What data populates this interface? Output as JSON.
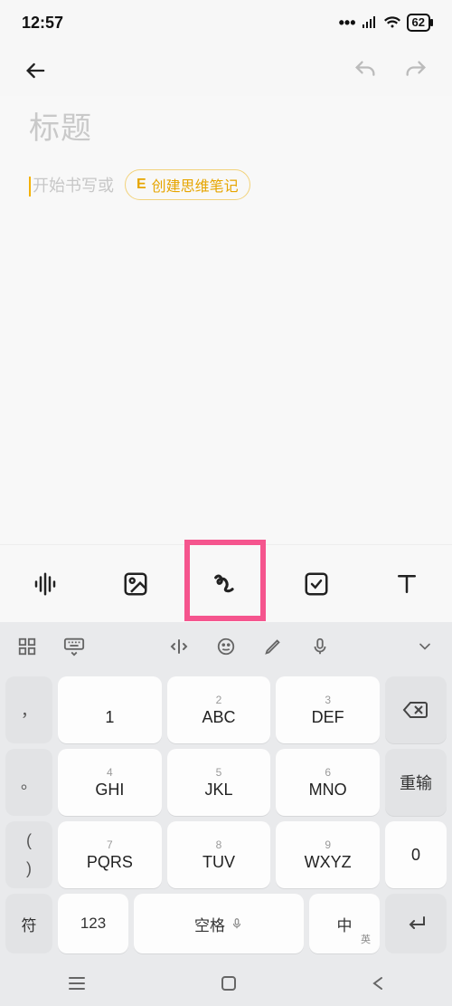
{
  "status": {
    "time": "12:57",
    "battery": "62"
  },
  "editor": {
    "title_placeholder": "标题",
    "body_placeholder": "开始书写或",
    "chip_icon_label": "E",
    "chip_text": "创建思维笔记"
  },
  "toolbar": {
    "items": [
      "voice",
      "image",
      "scribble",
      "checkbox",
      "text"
    ]
  },
  "keyboard": {
    "keys": [
      [
        {
          "n": "1",
          "l": ""
        },
        {
          "n": "2",
          "l": "ABC"
        },
        {
          "n": "3",
          "l": "DEF"
        }
      ],
      [
        {
          "n": "4",
          "l": "GHI"
        },
        {
          "n": "5",
          "l": "JKL"
        },
        {
          "n": "6",
          "l": "MNO"
        }
      ],
      [
        {
          "n": "7",
          "l": "PQRS"
        },
        {
          "n": "8",
          "l": "TUV"
        },
        {
          "n": "9",
          "l": "WXYZ"
        }
      ]
    ],
    "punct": [
      "，",
      "。",
      "(",
      ")"
    ],
    "right": {
      "reinput": "重输",
      "zero": "0"
    },
    "bottom": {
      "sym": "符",
      "num": "123",
      "space": "空格",
      "lang_main": "中",
      "lang_sub": "英"
    }
  }
}
